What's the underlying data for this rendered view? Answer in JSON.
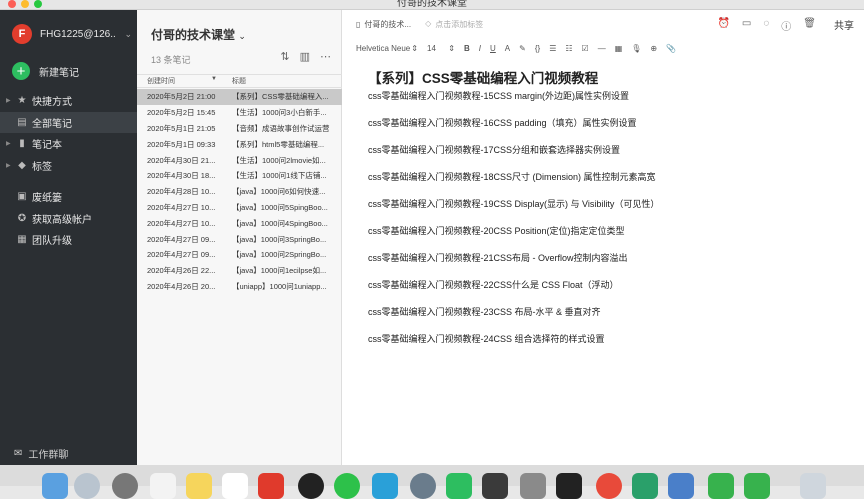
{
  "window": {
    "title": "付哥的技术课堂"
  },
  "sidebar": {
    "account": "FHG1225@126....",
    "avatar_letter": "F",
    "new_note": "新建笔记",
    "items": [
      {
        "label": "快捷方式",
        "icon": "star-icon",
        "caret": true
      },
      {
        "label": "全部笔记",
        "icon": "note-icon",
        "active": true
      },
      {
        "label": "笔记本",
        "icon": "notebook-icon",
        "caret": true
      },
      {
        "label": "标签",
        "icon": "tag-icon",
        "caret": true
      },
      {
        "label": "废纸篓",
        "icon": "trash-icon"
      },
      {
        "label": "获取高级帐户",
        "icon": "upgrade-icon"
      },
      {
        "label": "团队升级",
        "icon": "team-icon"
      }
    ],
    "work_group": "工作群聊"
  },
  "note_list": {
    "title": "付哥的技术课堂",
    "count": "13 条笔记",
    "headers": {
      "created": "创建时间",
      "title": "标题"
    },
    "rows": [
      {
        "date": "2020年5月2日 21:00",
        "title": "【系列】CSS零基础编程入...",
        "selected": true
      },
      {
        "date": "2020年5月2日 15:45",
        "title": "【生活】1000问3小白新手..."
      },
      {
        "date": "2020年5月1日 21:05",
        "title": "【音频】成语故事创作试运营"
      },
      {
        "date": "2020年5月1日 09:33",
        "title": "【系列】html5零基础编程..."
      },
      {
        "date": "2020年4月30日 21...",
        "title": "【生活】1000问2lmovie如..."
      },
      {
        "date": "2020年4月30日 18...",
        "title": "【生活】1000问1线下店铺..."
      },
      {
        "date": "2020年4月28日 10...",
        "title": "【java】1000问6如何快速..."
      },
      {
        "date": "2020年4月27日 10...",
        "title": "【java】1000问5SpingBoo..."
      },
      {
        "date": "2020年4月27日 10...",
        "title": "【java】1000问4SpingBoo..."
      },
      {
        "date": "2020年4月27日 09...",
        "title": "【java】1000问3SpringBo..."
      },
      {
        "date": "2020年4月27日 09...",
        "title": "【java】1000问2SpringBo..."
      },
      {
        "date": "2020年4月26日 22...",
        "title": "【java】1000问1ecilpse如..."
      },
      {
        "date": "2020年4月26日 20...",
        "title": "【uniapp】1000问1uniapp..."
      }
    ]
  },
  "editor": {
    "notebook": "付哥的技术...",
    "tag_placeholder": "点击添加标签",
    "share": "共享",
    "font": "Helvetica Neue",
    "font_size": "14",
    "title": "【系列】CSS零基础编程入门视频教程",
    "lines": [
      "css零基础编程入门视频教程-15CSS margin(外边距)属性实例设置",
      "css零基础编程入门视频教程-16CSS padding（填充）属性实例设置",
      "css零基础编程入门视频教程-17CSS分组和嵌套选择器实例设置",
      "css零基础编程入门视频教程-18CSS尺寸 (Dimension) 属性控制元素高宽",
      "css零基础编程入门视频教程-19CSS Display(显示) 与 Visibility（可见性）",
      "css零基础编程入门视频教程-20CSS Position(定位)指定定位类型",
      "css零基础编程入门视频教程-21CSS布局 - Overflow控制内容溢出",
      "css零基础编程入门视频教程-22CSS什么是 CSS Float（浮动）",
      "css零基础编程入门视频教程-23CSS 布局-水平 & 垂直对齐",
      "css零基础编程入门视频教程-24CSS 组合选择符的样式设置"
    ]
  },
  "colors": {
    "sidebar": "#2b2f33",
    "accent_green": "#2dbe60",
    "avatar_red": "#e23d2d"
  }
}
